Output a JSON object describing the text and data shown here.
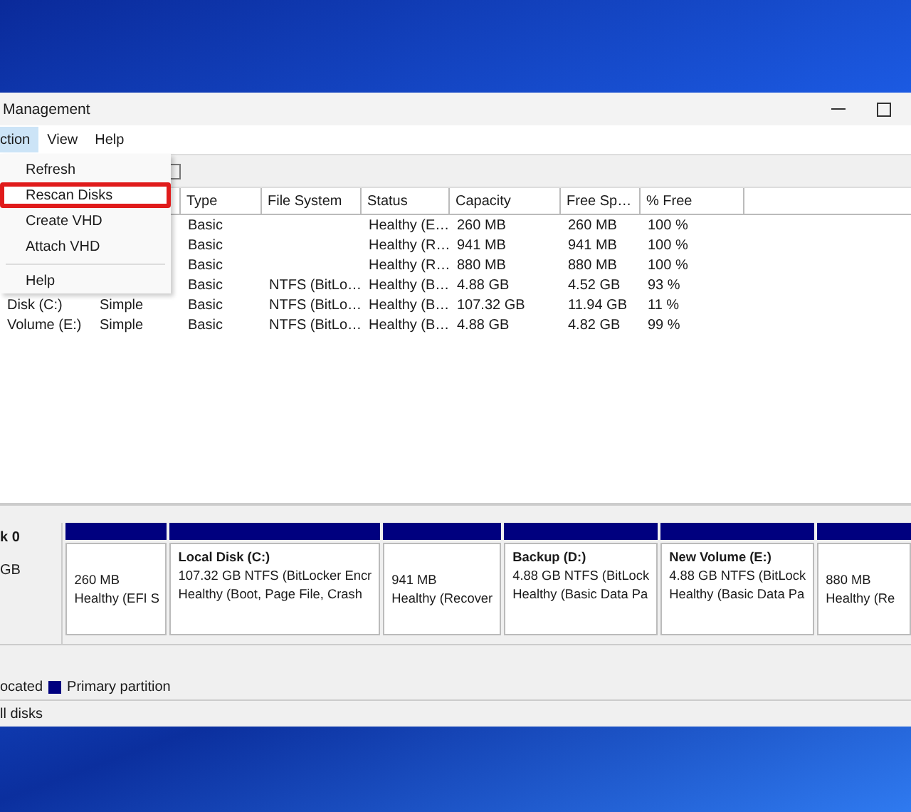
{
  "window": {
    "title": "Management"
  },
  "menubar": [
    {
      "label": "ction",
      "selected": true
    },
    {
      "label": "View",
      "selected": false
    },
    {
      "label": "Help",
      "selected": false
    }
  ],
  "action_menu": [
    {
      "kind": "item",
      "label": "Refresh",
      "selected": false
    },
    {
      "kind": "item",
      "label": "Rescan Disks",
      "selected": true
    },
    {
      "kind": "item",
      "label": "Create VHD",
      "selected": false
    },
    {
      "kind": "item",
      "label": "Attach VHD",
      "selected": false
    },
    {
      "kind": "separator"
    },
    {
      "kind": "item",
      "label": "Help",
      "selected": false
    }
  ],
  "table": {
    "columns": [
      "Type",
      "File System",
      "Status",
      "Capacity",
      "Free Sp…",
      "% Free"
    ],
    "rows": [
      {
        "cells": [
          "Basic",
          "",
          "Healthy (E…",
          "260 MB",
          "260 MB",
          "100 %"
        ]
      },
      {
        "cells": [
          "Basic",
          "",
          "Healthy (R…",
          "941 MB",
          "941 MB",
          "100 %"
        ]
      },
      {
        "cells": [
          "Basic",
          "",
          "Healthy (R…",
          "880 MB",
          "880 MB",
          "100 %"
        ]
      },
      {
        "cells": [
          "Basic",
          "NTFS (BitLo…",
          "Healthy (B…",
          "4.88 GB",
          "4.52 GB",
          "93 %"
        ]
      },
      {
        "volume": "Disk (C:)",
        "layout": "Simple",
        "cells": [
          "Basic",
          "NTFS (BitLo…",
          "Healthy (B…",
          "107.32 GB",
          "11.94 GB",
          "11 %"
        ]
      },
      {
        "volume": "Volume (E:)",
        "layout": "Simple",
        "cells": [
          "Basic",
          "NTFS (BitLo…",
          "Healthy (B…",
          "4.88 GB",
          "4.82 GB",
          "99 %"
        ]
      }
    ]
  },
  "disk": {
    "name": "k 0",
    "size": "GB",
    "partitions": [
      {
        "lines": [
          "260 MB",
          "Healthy (EFI S"
        ]
      },
      {
        "name": "Local Disk  (C:)",
        "lines": [
          "107.32 GB NTFS (BitLocker Encr",
          "Healthy (Boot, Page File, Crash"
        ]
      },
      {
        "lines": [
          "941 MB",
          "Healthy (Recover"
        ]
      },
      {
        "name": "Backup  (D:)",
        "lines": [
          "4.88 GB NTFS (BitLock",
          "Healthy (Basic Data Pa"
        ]
      },
      {
        "name": "New Volume  (E:)",
        "lines": [
          "4.88 GB NTFS (BitLock",
          "Healthy (Basic Data Pa"
        ]
      },
      {
        "lines": [
          "880 MB",
          "Healthy (Re"
        ]
      }
    ]
  },
  "legend": [
    {
      "label": "ocated"
    },
    {
      "label": "Primary partition",
      "color": "#00007f"
    }
  ],
  "status_bar": "ll disks"
}
